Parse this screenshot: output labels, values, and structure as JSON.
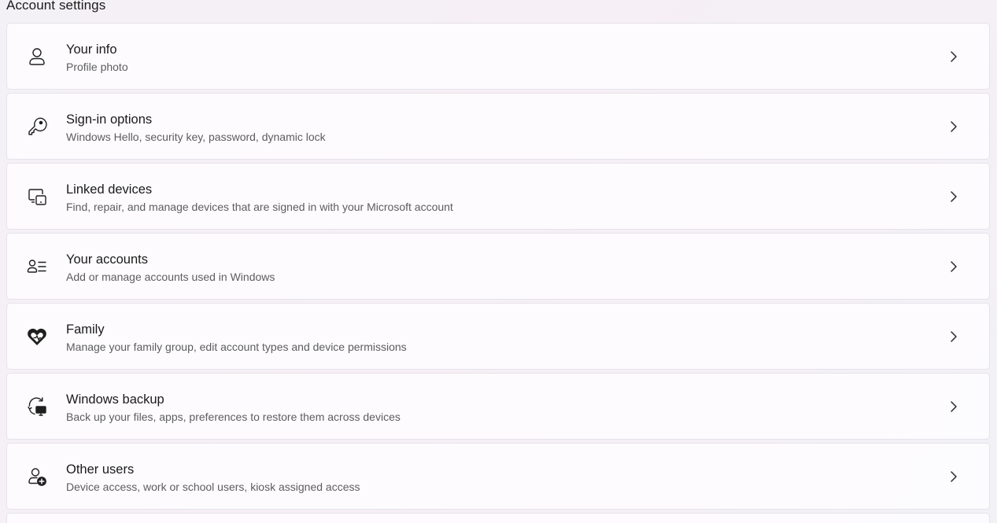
{
  "section": {
    "title": "Account settings"
  },
  "items": [
    {
      "id": "your-info",
      "icon": "person-icon",
      "title": "Your info",
      "subtitle": "Profile photo"
    },
    {
      "id": "sign-in-options",
      "icon": "key-icon",
      "title": "Sign-in options",
      "subtitle": "Windows Hello, security key, password, dynamic lock"
    },
    {
      "id": "linked-devices",
      "icon": "devices-icon",
      "title": "Linked devices",
      "subtitle": "Find, repair, and manage devices that are signed in with your Microsoft account"
    },
    {
      "id": "your-accounts",
      "icon": "accounts-list-icon",
      "title": "Your accounts",
      "subtitle": "Add or manage accounts used in Windows"
    },
    {
      "id": "family",
      "icon": "family-heart-icon",
      "title": "Family",
      "subtitle": "Manage your family group, edit account types and device permissions"
    },
    {
      "id": "windows-backup",
      "icon": "backup-sync-icon",
      "title": "Windows backup",
      "subtitle": "Back up your files, apps, preferences to restore them across devices"
    },
    {
      "id": "other-users",
      "icon": "add-person-icon",
      "title": "Other users",
      "subtitle": "Device access, work or school users, kiosk assigned access"
    }
  ]
}
